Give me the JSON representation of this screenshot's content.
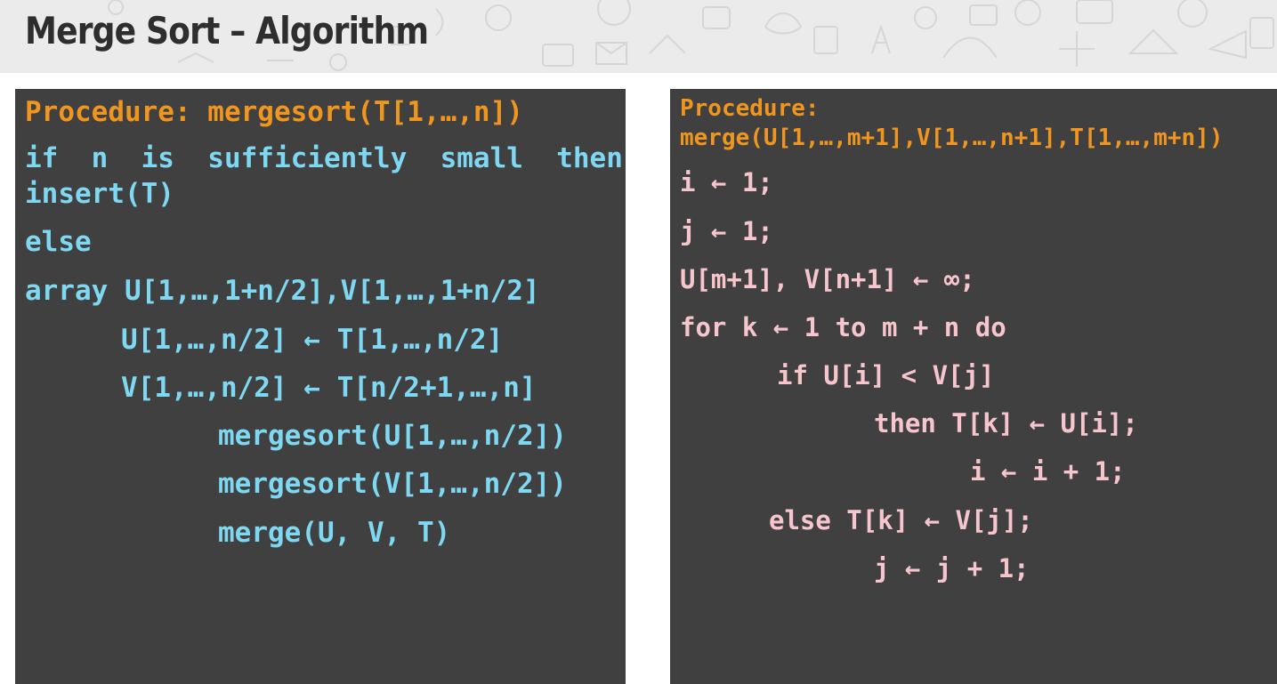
{
  "slide": {
    "title": "Merge Sort – Algorithm"
  },
  "mergesort": {
    "header": "Procedure: mergesort(T[1,…,n])",
    "lines": [
      "if  n  is  sufficiently  small  then",
      "insert(T)",
      "else",
      "array U[1,…,1+n/2],V[1,…,1+n/2]",
      "U[1,…,n/2] ← T[1,…,n/2]",
      "V[1,…,n/2] ← T[n/2+1,…,n]",
      "mergesort(U[1,…,n/2])",
      "mergesort(V[1,…,n/2])",
      "merge(U, V, T)"
    ]
  },
  "merge": {
    "header_1": "Procedure:",
    "header_2": "merge(U[1,…,m+1],V[1,…,n+1],T[1,…,m+n])",
    "lines": [
      "i ← 1;",
      "j ← 1;",
      "U[m+1], V[n+1] ← ∞;",
      "for k ← 1 to m + n do",
      "if U[i] < V[j]",
      "then T[k] ← U[i];",
      "i ← i + 1;",
      "else T[k] ← V[j];",
      "j ← j + 1;"
    ]
  }
}
